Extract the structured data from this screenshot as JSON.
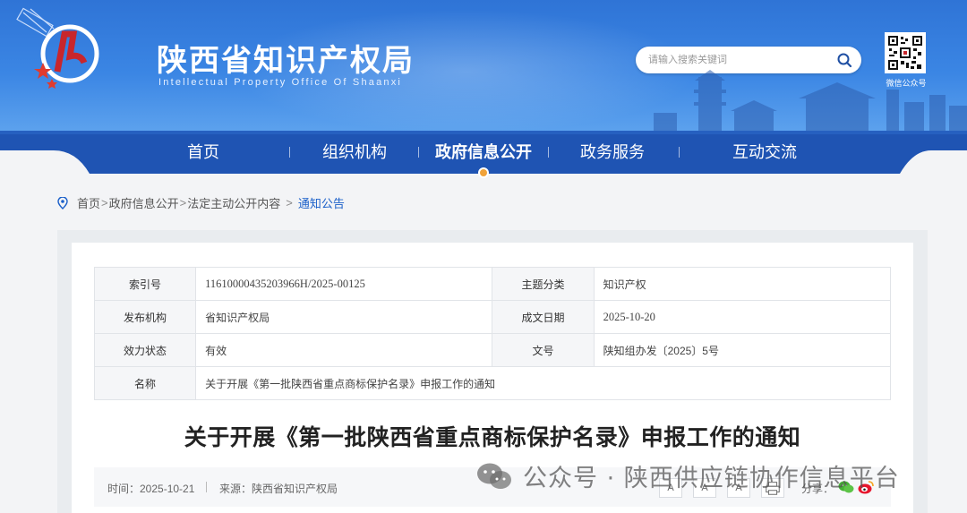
{
  "header": {
    "title": "陕西省知识产权局",
    "subtitle": "Intellectual Property Office Of Shaanxi",
    "search_placeholder": "请输入搜索关键词",
    "qr_label": "微信公众号"
  },
  "nav": {
    "items": [
      {
        "label": "首页"
      },
      {
        "label": "组织机构"
      },
      {
        "label": "政府信息公开"
      },
      {
        "label": "政务服务"
      },
      {
        "label": "互动交流"
      }
    ],
    "active_index": 2
  },
  "breadcrumb": {
    "items": [
      "首页",
      "政府信息公开",
      "法定主动公开内容",
      "通知公告"
    ],
    "separators": [
      ">",
      ">",
      ">"
    ]
  },
  "meta": {
    "index_no_label": "索引号",
    "index_no_value": "11610000435203966H/2025-00125",
    "topic_label": "主题分类",
    "topic_value": "知识产权",
    "publisher_label": "发布机构",
    "publisher_value": "省知识产权局",
    "date_label": "成文日期",
    "date_value": "2025-10-20",
    "status_label": "效力状态",
    "status_value": "有效",
    "doc_no_label": "文号",
    "doc_no_value": "陕知组办发〔2025〕5号",
    "name_label": "名称",
    "name_value": "关于开展《第一批陕西省重点商标保护名录》申报工作的通知"
  },
  "article": {
    "title": "关于开展《第一批陕西省重点商标保护名录》申报工作的通知",
    "time": "时间：2025-10-21",
    "source": "来源：陕西省知识产权局",
    "font_sizes": [
      "A",
      "A",
      "A"
    ],
    "share_label": "分享："
  },
  "watermark": {
    "text": "公众号 · 陕西供应链协作信息平台"
  },
  "colors": {
    "header_blue": "#2f74d6",
    "nav_blue": "#1f54b3",
    "link_blue": "#1a5fc9",
    "accent_orange": "#f0a23a"
  }
}
